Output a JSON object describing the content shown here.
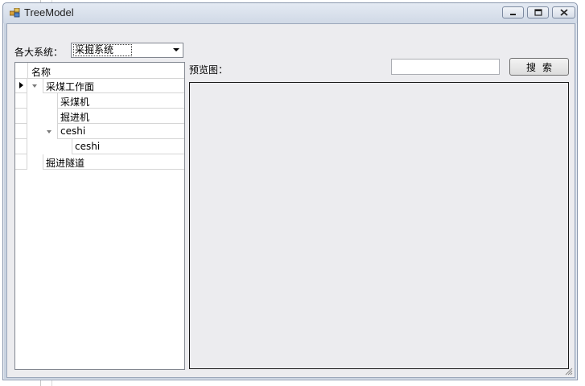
{
  "window": {
    "title": "TreeModel",
    "controls": {
      "minimize": "minimize",
      "maximize": "maximize",
      "close": "close"
    }
  },
  "system_selector": {
    "label": "各大系统：",
    "selected": "采掘系统"
  },
  "tree": {
    "column_header": "名称",
    "rows": [
      {
        "label": "采煤工作面",
        "level": 1,
        "expanded": true,
        "current": true
      },
      {
        "label": "采煤机",
        "level": 2
      },
      {
        "label": "掘进机",
        "level": 2
      },
      {
        "label": "ceshi",
        "level": 2,
        "expanded": true
      },
      {
        "label": "ceshi",
        "level": 3
      },
      {
        "label": "掘进隧道",
        "level": 1
      }
    ]
  },
  "preview": {
    "label": "预览图："
  },
  "search": {
    "value": "",
    "button_label": "搜索"
  },
  "colors": {
    "window_bg": "#ececef",
    "frame": "#c9d3e1",
    "border_dark": "#1a1a1a"
  }
}
